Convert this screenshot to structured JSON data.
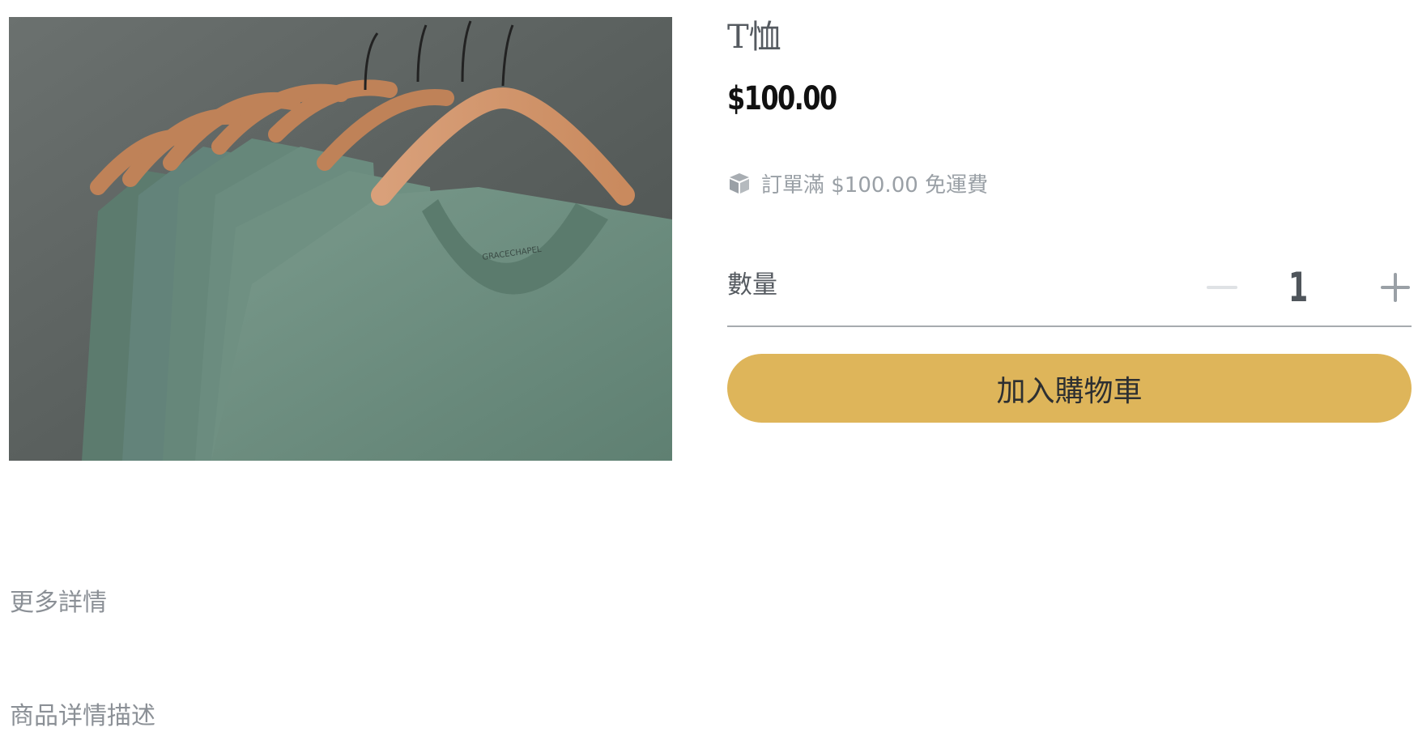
{
  "product": {
    "title": "T恤",
    "price": "$100.00",
    "image_alt": "T恤"
  },
  "shipping": {
    "icon": "box-icon",
    "text": "訂單滿 $100.00 免運費"
  },
  "quantity": {
    "label": "數量",
    "value": "1",
    "minus_icon": "minus-icon",
    "plus_icon": "plus-icon"
  },
  "cart": {
    "add_label": "加入購物車"
  },
  "details": {
    "more_label": "更多詳情",
    "description": "商品详情描述"
  },
  "colors": {
    "button": "#deb55a",
    "shirt": "#6e8f80",
    "background": "#ffffff"
  }
}
